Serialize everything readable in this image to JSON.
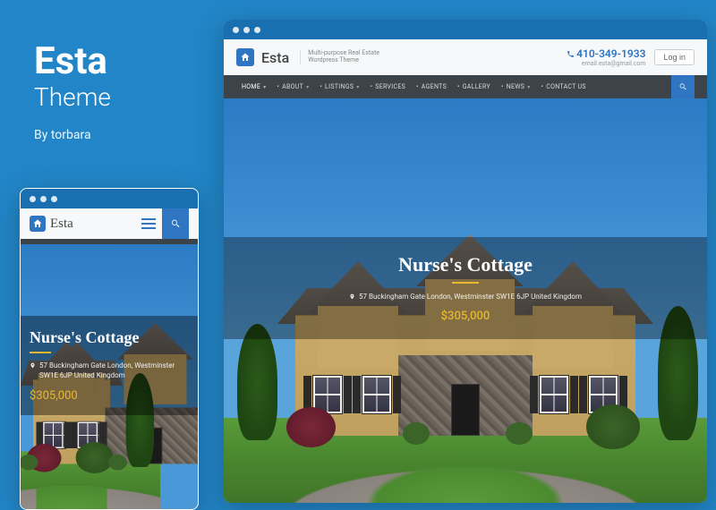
{
  "promo": {
    "title": "Esta",
    "subtitle": "Theme",
    "author": "By torbara"
  },
  "brand": {
    "name": "Esta",
    "tagline1": "Multi-purpose Real Estate",
    "tagline2": "Wordpress Theme"
  },
  "contact": {
    "phone": "410-349-1933",
    "email": "email.esta@gmail.com"
  },
  "login": "Log in",
  "nav": [
    {
      "label": "HOME",
      "dd": true,
      "active": true
    },
    {
      "label": "ABOUT",
      "dd": true
    },
    {
      "label": "LISTINGS",
      "dd": true
    },
    {
      "label": "SERVICES",
      "dd": false
    },
    {
      "label": "AGENTS",
      "dd": false
    },
    {
      "label": "GALLERY",
      "dd": false
    },
    {
      "label": "NEWS",
      "dd": true
    },
    {
      "label": "CONTACT US",
      "dd": false
    }
  ],
  "listing": {
    "title": "Nurse's Cottage",
    "address": "57 Buckingham Gate London, Westminster SW1E 6JP United Kingdom",
    "address_m1": "57 Buckingham Gate London, Westminster",
    "address_m2": "SW1E 6JP United Kingdom",
    "price": "$305,000"
  },
  "colors": {
    "accent": "#2f75c1",
    "gold": "#e8b730"
  }
}
